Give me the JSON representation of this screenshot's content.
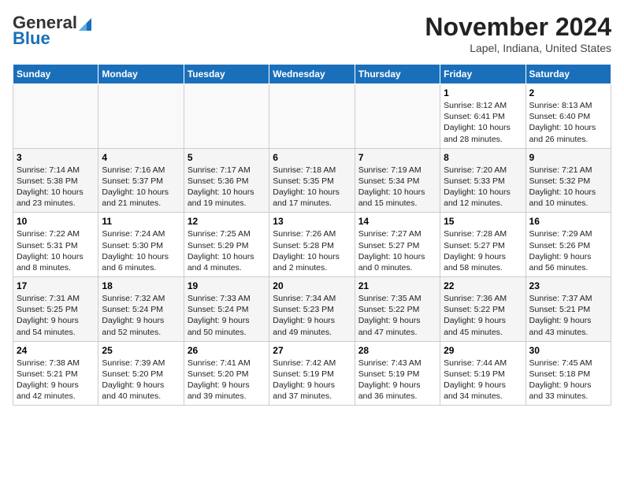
{
  "header": {
    "logo_general": "General",
    "logo_blue": "Blue",
    "title": "November 2024",
    "location": "Lapel, Indiana, United States"
  },
  "weekdays": [
    "Sunday",
    "Monday",
    "Tuesday",
    "Wednesday",
    "Thursday",
    "Friday",
    "Saturday"
  ],
  "weeks": [
    [
      {
        "day": "",
        "info": ""
      },
      {
        "day": "",
        "info": ""
      },
      {
        "day": "",
        "info": ""
      },
      {
        "day": "",
        "info": ""
      },
      {
        "day": "",
        "info": ""
      },
      {
        "day": "1",
        "info": "Sunrise: 8:12 AM\nSunset: 6:41 PM\nDaylight: 10 hours\nand 28 minutes."
      },
      {
        "day": "2",
        "info": "Sunrise: 8:13 AM\nSunset: 6:40 PM\nDaylight: 10 hours\nand 26 minutes."
      }
    ],
    [
      {
        "day": "3",
        "info": "Sunrise: 7:14 AM\nSunset: 5:38 PM\nDaylight: 10 hours\nand 23 minutes."
      },
      {
        "day": "4",
        "info": "Sunrise: 7:16 AM\nSunset: 5:37 PM\nDaylight: 10 hours\nand 21 minutes."
      },
      {
        "day": "5",
        "info": "Sunrise: 7:17 AM\nSunset: 5:36 PM\nDaylight: 10 hours\nand 19 minutes."
      },
      {
        "day": "6",
        "info": "Sunrise: 7:18 AM\nSunset: 5:35 PM\nDaylight: 10 hours\nand 17 minutes."
      },
      {
        "day": "7",
        "info": "Sunrise: 7:19 AM\nSunset: 5:34 PM\nDaylight: 10 hours\nand 15 minutes."
      },
      {
        "day": "8",
        "info": "Sunrise: 7:20 AM\nSunset: 5:33 PM\nDaylight: 10 hours\nand 12 minutes."
      },
      {
        "day": "9",
        "info": "Sunrise: 7:21 AM\nSunset: 5:32 PM\nDaylight: 10 hours\nand 10 minutes."
      }
    ],
    [
      {
        "day": "10",
        "info": "Sunrise: 7:22 AM\nSunset: 5:31 PM\nDaylight: 10 hours\nand 8 minutes."
      },
      {
        "day": "11",
        "info": "Sunrise: 7:24 AM\nSunset: 5:30 PM\nDaylight: 10 hours\nand 6 minutes."
      },
      {
        "day": "12",
        "info": "Sunrise: 7:25 AM\nSunset: 5:29 PM\nDaylight: 10 hours\nand 4 minutes."
      },
      {
        "day": "13",
        "info": "Sunrise: 7:26 AM\nSunset: 5:28 PM\nDaylight: 10 hours\nand 2 minutes."
      },
      {
        "day": "14",
        "info": "Sunrise: 7:27 AM\nSunset: 5:27 PM\nDaylight: 10 hours\nand 0 minutes."
      },
      {
        "day": "15",
        "info": "Sunrise: 7:28 AM\nSunset: 5:27 PM\nDaylight: 9 hours\nand 58 minutes."
      },
      {
        "day": "16",
        "info": "Sunrise: 7:29 AM\nSunset: 5:26 PM\nDaylight: 9 hours\nand 56 minutes."
      }
    ],
    [
      {
        "day": "17",
        "info": "Sunrise: 7:31 AM\nSunset: 5:25 PM\nDaylight: 9 hours\nand 54 minutes."
      },
      {
        "day": "18",
        "info": "Sunrise: 7:32 AM\nSunset: 5:24 PM\nDaylight: 9 hours\nand 52 minutes."
      },
      {
        "day": "19",
        "info": "Sunrise: 7:33 AM\nSunset: 5:24 PM\nDaylight: 9 hours\nand 50 minutes."
      },
      {
        "day": "20",
        "info": "Sunrise: 7:34 AM\nSunset: 5:23 PM\nDaylight: 9 hours\nand 49 minutes."
      },
      {
        "day": "21",
        "info": "Sunrise: 7:35 AM\nSunset: 5:22 PM\nDaylight: 9 hours\nand 47 minutes."
      },
      {
        "day": "22",
        "info": "Sunrise: 7:36 AM\nSunset: 5:22 PM\nDaylight: 9 hours\nand 45 minutes."
      },
      {
        "day": "23",
        "info": "Sunrise: 7:37 AM\nSunset: 5:21 PM\nDaylight: 9 hours\nand 43 minutes."
      }
    ],
    [
      {
        "day": "24",
        "info": "Sunrise: 7:38 AM\nSunset: 5:21 PM\nDaylight: 9 hours\nand 42 minutes."
      },
      {
        "day": "25",
        "info": "Sunrise: 7:39 AM\nSunset: 5:20 PM\nDaylight: 9 hours\nand 40 minutes."
      },
      {
        "day": "26",
        "info": "Sunrise: 7:41 AM\nSunset: 5:20 PM\nDaylight: 9 hours\nand 39 minutes."
      },
      {
        "day": "27",
        "info": "Sunrise: 7:42 AM\nSunset: 5:19 PM\nDaylight: 9 hours\nand 37 minutes."
      },
      {
        "day": "28",
        "info": "Sunrise: 7:43 AM\nSunset: 5:19 PM\nDaylight: 9 hours\nand 36 minutes."
      },
      {
        "day": "29",
        "info": "Sunrise: 7:44 AM\nSunset: 5:19 PM\nDaylight: 9 hours\nand 34 minutes."
      },
      {
        "day": "30",
        "info": "Sunrise: 7:45 AM\nSunset: 5:18 PM\nDaylight: 9 hours\nand 33 minutes."
      }
    ]
  ]
}
